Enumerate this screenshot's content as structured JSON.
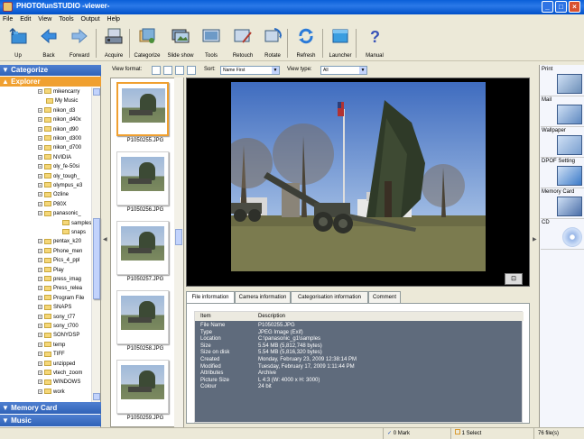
{
  "window": {
    "title": "PHOTOfunSTUDIO -viewer-"
  },
  "menu": [
    "File",
    "Edit",
    "View",
    "Tools",
    "Output",
    "Help"
  ],
  "toolbar": {
    "buttons": [
      {
        "label": "Up",
        "icon": "folder-up-icon"
      },
      {
        "label": "Back",
        "icon": "back-arrow-icon"
      },
      {
        "label": "Forward",
        "icon": "forward-arrow-icon"
      },
      {
        "label": "Acquire",
        "icon": "acquire-icon"
      },
      {
        "label": "Categorize",
        "icon": "categorize-icon"
      },
      {
        "label": "Slide show",
        "icon": "slideshow-icon"
      },
      {
        "label": "Tools",
        "icon": "tools-icon"
      },
      {
        "label": "Retouch",
        "icon": "retouch-icon"
      },
      {
        "label": "Rotate",
        "icon": "rotate-icon"
      },
      {
        "label": "Refresh",
        "icon": "refresh-icon"
      },
      {
        "label": "Launcher",
        "icon": "launcher-icon"
      },
      {
        "label": "Manual",
        "icon": "help-icon"
      }
    ]
  },
  "left": {
    "categorize_label": "Categorize",
    "explorer_label": "Explorer",
    "tree": [
      "mikencarry",
      "My Music",
      "nikon_d3",
      "nikon_d40x",
      "nikon_d90",
      "nikon_d300",
      "nikon_d700",
      "NVIDIA",
      "oly_fe-50si",
      "oly_tough_",
      "olympus_e3",
      "Ozline",
      "P80X",
      "panasonic_",
      "samples",
      "snaps",
      "pentax_k20",
      "Phone_men",
      "Pics_4_ppl",
      "Play",
      "press_imag",
      "Press_relea",
      "Program File",
      "SNAPS",
      "sony_t77",
      "sony_t700",
      "SONYDSP",
      "temp",
      "TIFF",
      "unzipped",
      "vtech_zoom",
      "WINDOWS",
      "work"
    ],
    "memory_card_label": "Memory Card",
    "music_label": "Music"
  },
  "options": {
    "view_format_label": "View format:",
    "sort_label": "Sort:",
    "sort_value": "Name First",
    "view_type_label": "View type:",
    "view_type_value": "All"
  },
  "thumbnails": [
    "P1050255.JPG",
    "P1050256.JPG",
    "P1050257.JPG",
    "P1050258.JPG",
    "P1050259.JPG"
  ],
  "tabs": [
    "File information",
    "Camera information",
    "Categorisation information",
    "Comment"
  ],
  "info": {
    "header_item": "Item",
    "header_desc": "Description",
    "rows": [
      {
        "k": "File Name",
        "v": "P1050255.JPG"
      },
      {
        "k": "Type",
        "v": "JPEG Image (Exif)"
      },
      {
        "k": "Location",
        "v": "C:\\panasonic_g1\\samples"
      },
      {
        "k": "Size",
        "v": "5.54 MB (5,812,748 bytes)"
      },
      {
        "k": "Size on disk",
        "v": "5.54 MB (5,816,320 bytes)"
      },
      {
        "k": "Created",
        "v": "Monday, February 23, 2009 12:38:14 PM"
      },
      {
        "k": "Modified",
        "v": "Tuesday, February 17, 2009 1:11:44 PM"
      },
      {
        "k": "Attributes",
        "v": "Archive"
      },
      {
        "k": "Picture Size",
        "v": "L 4:3 (W: 4000 x H: 3000)"
      },
      {
        "k": "Colour",
        "v": "24 bit"
      }
    ]
  },
  "right": {
    "tools": [
      "Print",
      "Mail",
      "Wallpaper",
      "DPOF Setting",
      "Memory Card",
      "CD"
    ]
  },
  "status": {
    "mark": "0 Mark",
    "select": "1 Select",
    "files": "76 file(s)"
  }
}
